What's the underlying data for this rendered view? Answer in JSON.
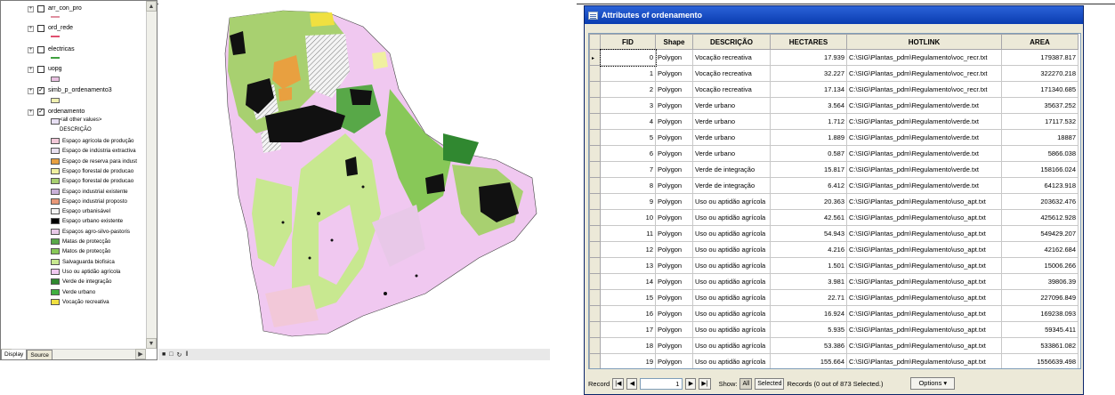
{
  "toc": {
    "layers": [
      {
        "name": "arr_con_pro",
        "checked": false
      },
      {
        "name": "ord_rede",
        "checked": false
      },
      {
        "name": "electricas",
        "checked": false
      },
      {
        "name": "uopg",
        "checked": false
      },
      {
        "name": "simb_p_ordenamento3",
        "checked": true
      },
      {
        "name": "ordenamento",
        "checked": true
      }
    ],
    "legend_heading_values": "<all other values>",
    "legend_heading_field": "DESCRIÇÃO",
    "legend": [
      {
        "label": "Espaço agrícola de produção",
        "color": "#f2c8d8"
      },
      {
        "label": "Espaço de indústria extractiva",
        "color": "#e8e0f0"
      },
      {
        "label": "Espaço de reserva para indust",
        "color": "#e8a040"
      },
      {
        "label": "Espaço florestal de producao",
        "color": "#f0f0a0"
      },
      {
        "label": "Espaço florestal de producao",
        "color": "#a8d070"
      },
      {
        "label": "Espaço industrial existente",
        "color": "#c8b0d8"
      },
      {
        "label": "Espaço industrial proposto",
        "color": "#e89878"
      },
      {
        "label": "Espaço urbanisável",
        "color": "#f4f4f4"
      },
      {
        "label": "Espaço urbano existente",
        "color": "#000000"
      },
      {
        "label": "Espaços agro-silvo-pastoris",
        "color": "#e8c8e8"
      },
      {
        "label": "Matas de protecção",
        "color": "#58a848"
      },
      {
        "label": "Matos de protecção",
        "color": "#88c858"
      },
      {
        "label": "Salvaguarda biofisica",
        "color": "#c8e890"
      },
      {
        "label": "Uso ou aptidão agrícola",
        "color": "#f0c8f0"
      },
      {
        "label": "Verde de integração",
        "color": "#308830"
      },
      {
        "label": "Verde urbano",
        "color": "#40b040"
      },
      {
        "label": "Vocação recreativa",
        "color": "#f0e040"
      }
    ],
    "tabs": [
      "Display",
      "Source"
    ]
  },
  "attributes": {
    "title": "Attributes of ordenamento",
    "columns": [
      "FID",
      "Shape",
      "DESCRIÇÃO",
      "HECTARES",
      "HOTLINK",
      "AREA"
    ],
    "rows": [
      [
        "0",
        "Polygon",
        "Vocação recreativa",
        "17.939",
        "C:\\SIG\\Plantas_pdm\\Regulamento\\voc_recr.txt",
        "179387.817"
      ],
      [
        "1",
        "Polygon",
        "Vocação recreativa",
        "32.227",
        "C:\\SIG\\Plantas_pdm\\Regulamento\\voc_recr.txt",
        "322270.218"
      ],
      [
        "2",
        "Polygon",
        "Vocação recreativa",
        "17.134",
        "C:\\SIG\\Plantas_pdm\\Regulamento\\voc_recr.txt",
        "171340.685"
      ],
      [
        "3",
        "Polygon",
        "Verde urbano",
        "3.564",
        "C:\\SIG\\Plantas_pdm\\Regulamento\\verde.txt",
        "35637.252"
      ],
      [
        "4",
        "Polygon",
        "Verde urbano",
        "1.712",
        "C:\\SIG\\Plantas_pdm\\Regulamento\\verde.txt",
        "17117.532"
      ],
      [
        "5",
        "Polygon",
        "Verde urbano",
        "1.889",
        "C:\\SIG\\Plantas_pdm\\Regulamento\\verde.txt",
        "18887"
      ],
      [
        "6",
        "Polygon",
        "Verde urbano",
        "0.587",
        "C:\\SIG\\Plantas_pdm\\Regulamento\\verde.txt",
        "5866.038"
      ],
      [
        "7",
        "Polygon",
        "Verde de integração",
        "15.817",
        "C:\\SIG\\Plantas_pdm\\Regulamento\\verde.txt",
        "158166.024"
      ],
      [
        "8",
        "Polygon",
        "Verde de integração",
        "6.412",
        "C:\\SIG\\Plantas_pdm\\Regulamento\\verde.txt",
        "64123.918"
      ],
      [
        "9",
        "Polygon",
        "Uso ou aptidão agrícola",
        "20.363",
        "C:\\SIG\\Plantas_pdm\\Regulamento\\uso_apt.txt",
        "203632.476"
      ],
      [
        "10",
        "Polygon",
        "Uso ou aptidão agrícola",
        "42.561",
        "C:\\SIG\\Plantas_pdm\\Regulamento\\uso_apt.txt",
        "425612.928"
      ],
      [
        "11",
        "Polygon",
        "Uso ou aptidão agrícola",
        "54.943",
        "C:\\SIG\\Plantas_pdm\\Regulamento\\uso_apt.txt",
        "549429.207"
      ],
      [
        "12",
        "Polygon",
        "Uso ou aptidão agrícola",
        "4.216",
        "C:\\SIG\\Plantas_pdm\\Regulamento\\uso_apt.txt",
        "42162.684"
      ],
      [
        "13",
        "Polygon",
        "Uso ou aptidão agrícola",
        "1.501",
        "C:\\SIG\\Plantas_pdm\\Regulamento\\uso_apt.txt",
        "15006.266"
      ],
      [
        "14",
        "Polygon",
        "Uso ou aptidão agrícola",
        "3.981",
        "C:\\SIG\\Plantas_pdm\\Regulamento\\uso_apt.txt",
        "39806.39"
      ],
      [
        "15",
        "Polygon",
        "Uso ou aptidão agrícola",
        "22.71",
        "C:\\SIG\\Plantas_pdm\\Regulamento\\uso_apt.txt",
        "227096.849"
      ],
      [
        "16",
        "Polygon",
        "Uso ou aptidão agrícola",
        "16.924",
        "C:\\SIG\\Plantas_pdm\\Regulamento\\uso_apt.txt",
        "169238.093"
      ],
      [
        "17",
        "Polygon",
        "Uso ou aptidão agrícola",
        "5.935",
        "C:\\SIG\\Plantas_pdm\\Regulamento\\uso_apt.txt",
        "59345.411"
      ],
      [
        "18",
        "Polygon",
        "Uso ou aptidão agrícola",
        "53.386",
        "C:\\SIG\\Plantas_pdm\\Regulamento\\uso_apt.txt",
        "533861.082"
      ],
      [
        "19",
        "Polygon",
        "Uso ou aptidão agrícola",
        "155.664",
        "C:\\SIG\\Plantas_pdm\\Regulamento\\uso_apt.txt",
        "1556639.498"
      ]
    ],
    "record_label": "Record",
    "record_value": "1",
    "show_label": "Show:",
    "show_all": "All",
    "show_selected": "Selected",
    "records_text": "Records (0 out of 873 Selected.)",
    "options_label": "Options"
  }
}
